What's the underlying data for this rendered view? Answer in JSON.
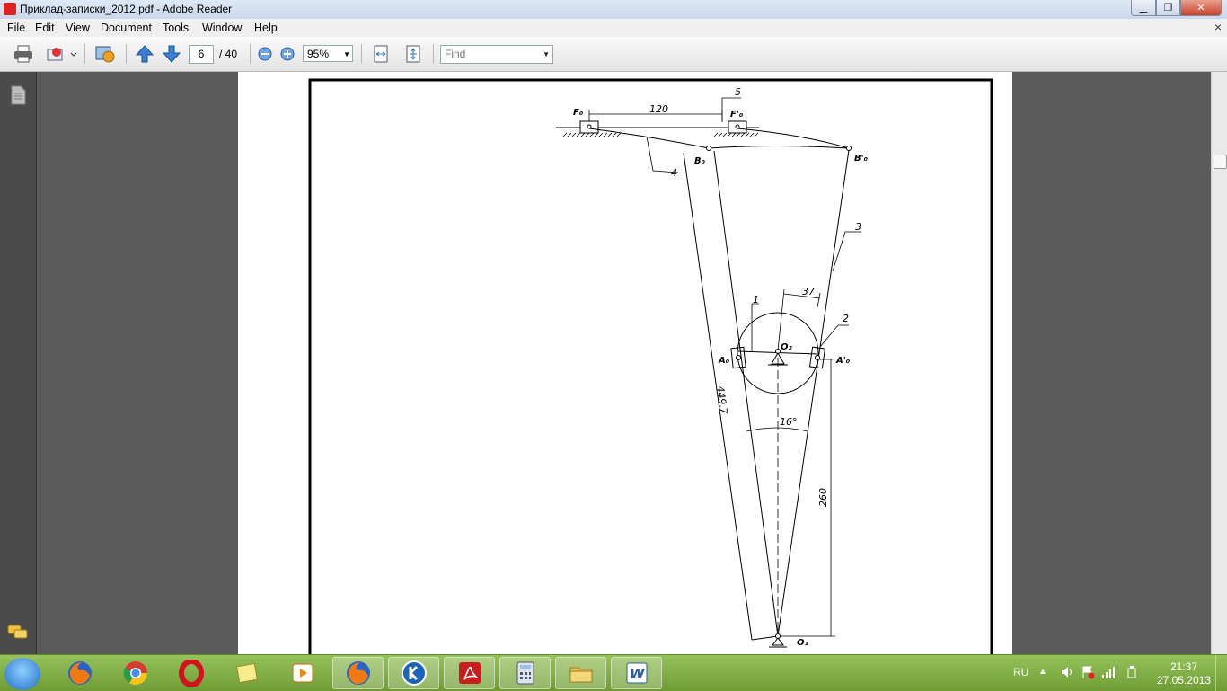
{
  "window": {
    "title": "Приклад-записки_2012.pdf - Adobe Reader",
    "min_label": "▁",
    "max_label": "❐",
    "close_label": "✕"
  },
  "menu": {
    "items": [
      "File",
      "Edit",
      "View",
      "Document",
      "Tools",
      "Window",
      "Help"
    ],
    "close_doc": "×"
  },
  "toolbar": {
    "page_current": "6",
    "page_total": "/ 40",
    "zoom": "95%",
    "find_placeholder": "Find"
  },
  "drawing": {
    "labels": {
      "dim_top": "120",
      "num5": "5",
      "num4": "4",
      "num3": "3",
      "num1": "1",
      "num2": "2",
      "dim37": "37",
      "dim449": "449,7",
      "angle": "16°",
      "dim260": "260",
      "F0": "F₀",
      "F0p": "F'₀",
      "B0": "B₀",
      "B0p": "B'₀",
      "A0": "A₀",
      "A0p": "A'₀",
      "O2": "O₂",
      "O1": "O₁"
    }
  },
  "taskbar": {
    "apps": [
      "firefox-icon",
      "chrome-icon",
      "opera-icon",
      "notes-icon",
      "media-player-icon",
      "firefox-icon",
      "k-browser-icon",
      "acrobat-icon",
      "calculator-icon",
      "explorer-icon",
      "word-icon"
    ],
    "lang": "RU",
    "time": "21:37",
    "date": "27.05.2013"
  }
}
